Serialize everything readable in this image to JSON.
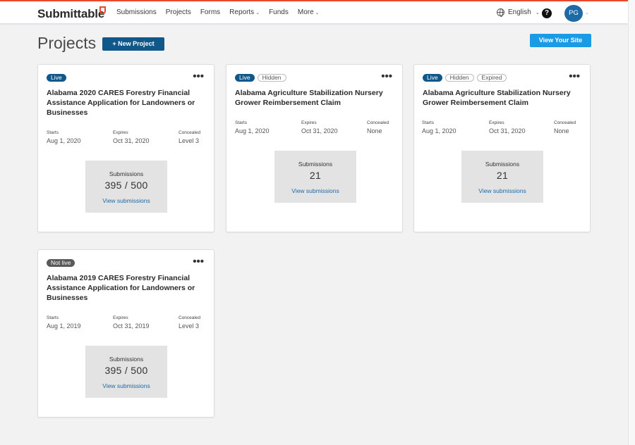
{
  "header": {
    "logo_text": "Submittable",
    "nav": [
      {
        "label": "Submissions",
        "caret": false
      },
      {
        "label": "Projects",
        "caret": false
      },
      {
        "label": "Forms",
        "caret": false
      },
      {
        "label": "Reports",
        "caret": true
      },
      {
        "label": "Funds",
        "caret": false
      },
      {
        "label": "More",
        "caret": true
      }
    ],
    "language": "English",
    "help_glyph": "?",
    "avatar_initials": "PG"
  },
  "page": {
    "title": "Projects",
    "new_project_label": "+ New Project",
    "view_site_label": "View Your Site"
  },
  "labels": {
    "starts": "Starts",
    "expires": "Expires",
    "concealed": "Concealed",
    "submissions": "Submissions",
    "view_submissions": "View submissions",
    "more_glyph": "•••"
  },
  "cards": [
    {
      "badges": [
        "Live"
      ],
      "title": "Alabama 2020 CARES Forestry Financial Assistance Application for Landowners or Businesses",
      "starts": "Aug 1, 2020",
      "expires": "Oct 31, 2020",
      "concealed": "Level 3",
      "submissions": "395 / 500"
    },
    {
      "badges": [
        "Live",
        "Hidden"
      ],
      "title": "Alabama Agriculture Stabilization Nursery Grower Reimbersement Claim",
      "starts": "Aug 1, 2020",
      "expires": "Oct 31, 2020",
      "concealed": "None",
      "submissions": "21"
    },
    {
      "badges": [
        "Live",
        "Hidden",
        "Expired"
      ],
      "title": "Alabama Agriculture Stabilization Nursery Grower Reimbersement Claim",
      "starts": "Aug 1, 2020",
      "expires": "Oct 31, 2020",
      "concealed": "None",
      "submissions": "21"
    },
    {
      "badges": [
        "Not live"
      ],
      "title": "Alabama 2019 CARES Forestry Financial Assistance Application for Landowners or Businesses",
      "starts": "Aug 1, 2019",
      "expires": "Oct 31, 2019",
      "concealed": "Level 3",
      "submissions": "395 / 500"
    }
  ]
}
